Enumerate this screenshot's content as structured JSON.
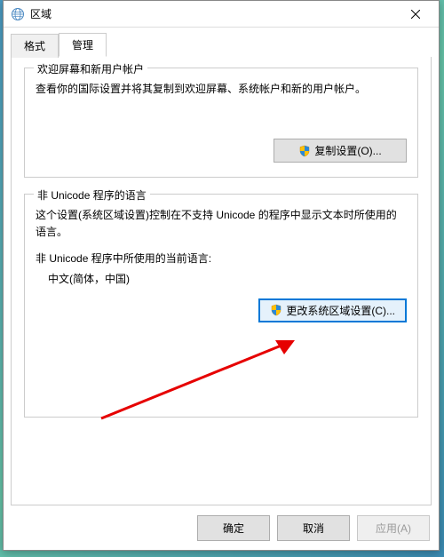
{
  "window": {
    "title": "区域"
  },
  "tabs": [
    {
      "label": "格式"
    },
    {
      "label": "管理",
      "active": true
    }
  ],
  "group1": {
    "title": "欢迎屏幕和新用户帐户",
    "text": "查看你的国际设置并将其复制到欢迎屏幕、系统帐户和新的用户帐户。",
    "button": "复制设置(O)..."
  },
  "group2": {
    "title": "非 Unicode 程序的语言",
    "text": "这个设置(系统区域设置)控制在不支持 Unicode 的程序中显示文本时所使用的语言。",
    "sublabel": "非 Unicode 程序中所使用的当前语言:",
    "value": "中文(简体，中国)",
    "button": "更改系统区域设置(C)..."
  },
  "footer": {
    "ok": "确定",
    "cancel": "取消",
    "apply": "应用(A)"
  }
}
